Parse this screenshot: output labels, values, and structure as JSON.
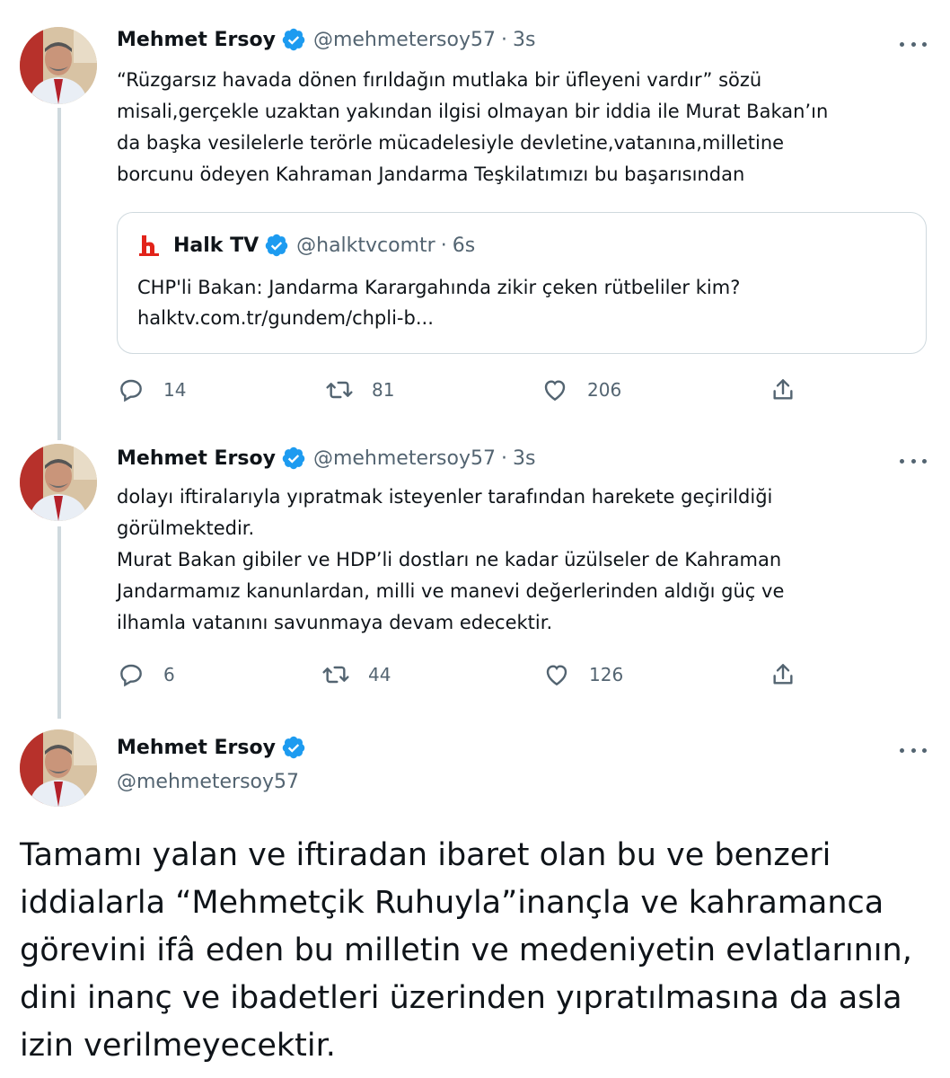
{
  "tweets": [
    {
      "name": "Mehmet Ersoy",
      "handle": "@mehmetersoy57",
      "separator": "·",
      "time": "3s",
      "text": "“Rüzgarsız havada dönen fırıldağın mutlaka bir üfleyeni vardır” sözü\nmisali,gerçekle uzaktan yakından ilgisi olmayan bir iddia ile Murat Bakan’ın\nda başka vesilelerle terörle mücadelesiyle devletine,vatanına,milletine\nborcunu ödeyen Kahraman Jandarma Teşkilatımızı bu başarısından",
      "quote": {
        "name": "Halk TV",
        "handle": "@halktvcomtr",
        "separator": "·",
        "time": "6s",
        "text": "CHP'li Bakan: Jandarma Karargahında zikir çeken rütbeliler kim?\nhalktv.com.tr/gundem/chpli-b..."
      },
      "replies": "14",
      "retweets": "81",
      "likes": "206"
    },
    {
      "name": "Mehmet Ersoy",
      "handle": "@mehmetersoy57",
      "separator": "·",
      "time": "3s",
      "text": "dolayı iftiralarıyla yıpratmak isteyenler tarafından harekete geçirildiği\ngörülmektedir.\nMurat Bakan gibiler ve HDP’li dostları ne kadar üzülseler de Kahraman\nJandarmamız kanunlardan, milli ve manevi değerlerinden aldığı güç ve\nilhamla vatanını savunmaya devam edecektir.",
      "replies": "6",
      "retweets": "44",
      "likes": "126"
    },
    {
      "name": "Mehmet Ersoy",
      "handle": "@mehmetersoy57",
      "text": "Tamamı yalan ve iftiradan ibaret olan bu ve benzeri\niddialarla “Mehmetçik Ruhuyla”inançla ve kahramanca\ngörevini ifâ eden bu milletin ve medeniyetin evlatlarının,\ndini inanç ve ibadetleri üzerinden yıpratılmasına da asla\nizin verilmeyecektir."
    }
  ],
  "colors": {
    "verified": "#1d9bf0",
    "secondary_text": "#536471",
    "thread_line": "#cfd9de",
    "halktv_red": "#e2231a"
  },
  "icons": [
    "verified-badge-icon",
    "more-icon",
    "reply-icon",
    "retweet-icon",
    "like-icon",
    "share-icon",
    "halktv-logo"
  ]
}
